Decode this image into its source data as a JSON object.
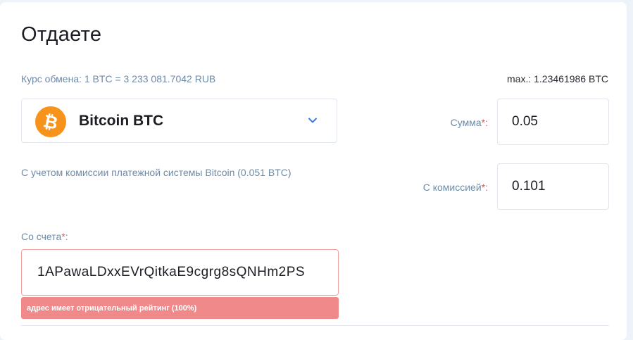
{
  "section": {
    "title": "Отдаете",
    "rate_text": "Курс обмена: 1 BTC = 3 233 081.7042 RUB",
    "max_text": "max.: 1.23461986 BTC"
  },
  "currency": {
    "name": "Bitcoin BTC",
    "icon": "bitcoin-icon",
    "icon_color": "#f7931a"
  },
  "amount": {
    "label": "Сумма",
    "required_mark": "*:",
    "value": "0.05"
  },
  "commission": {
    "note": "С учетом комиссии платежной системы Bitcoin (0.051 BTC)",
    "label": "С комиссией",
    "required_mark": "*:",
    "value": "0.101"
  },
  "account": {
    "label": "Со счета",
    "required_mark": "*",
    "label_suffix": ":",
    "value": "1APawaLDxxEVrQitkaE9cgrg8sQNHm2PS",
    "error": "адрес имеет отрицательный рейтинг (100%)",
    "error_color": "#f08a8a"
  }
}
